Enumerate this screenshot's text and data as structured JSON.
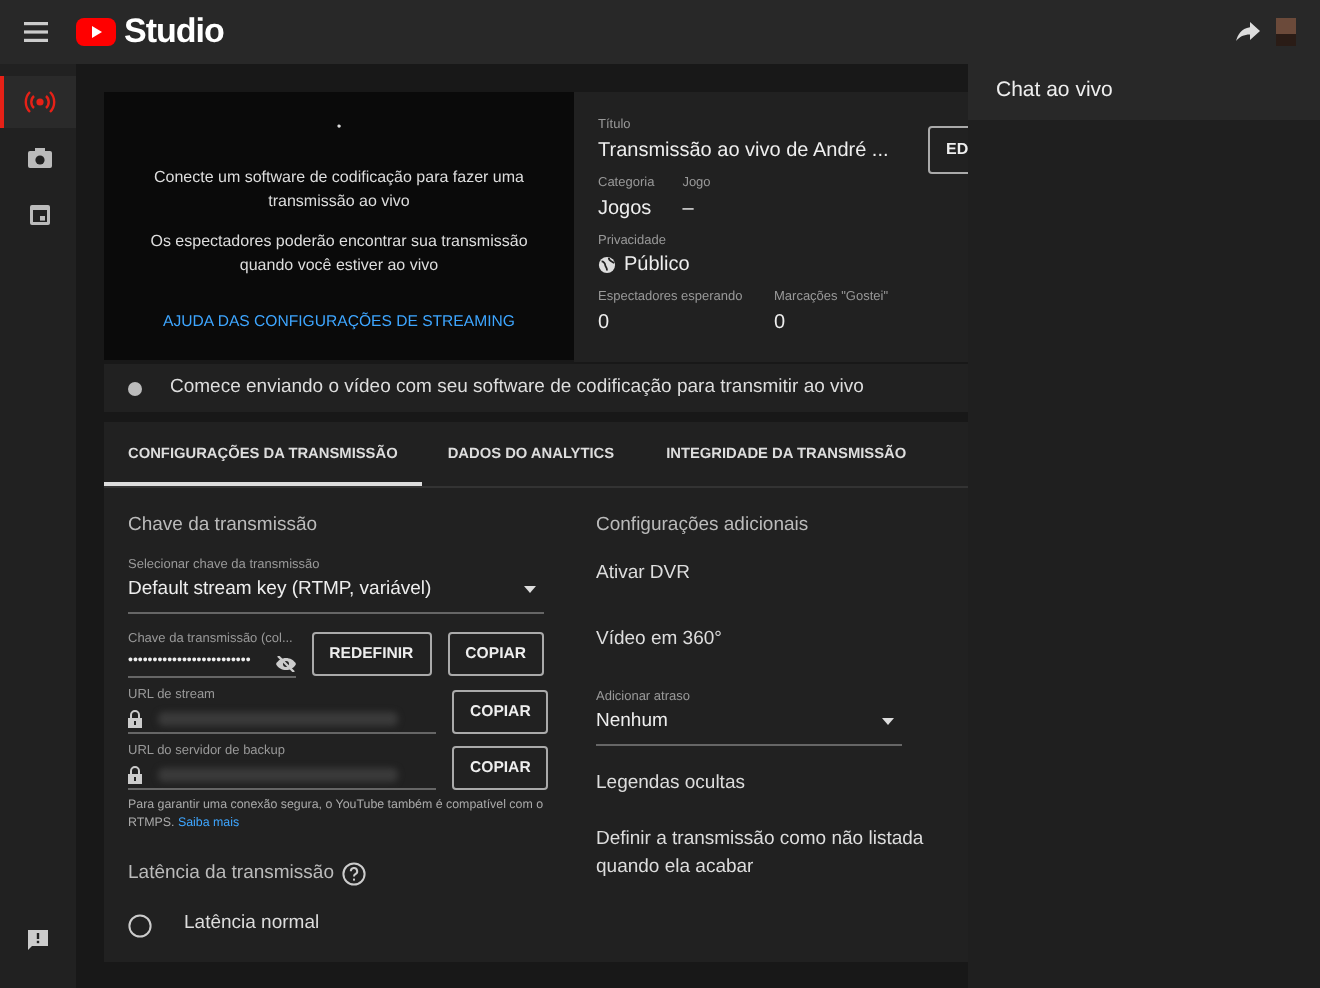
{
  "topbar": {
    "logo_text": "Studio"
  },
  "sidebar": {
    "items": [
      {
        "selected": true
      },
      {
        "selected": false
      },
      {
        "selected": false
      }
    ]
  },
  "preview": {
    "dot": "•",
    "lines": [
      "Conecte um software de codificação para fazer uma transmissão ao vivo",
      "Os espectadores poderão encontrar sua transmissão quando você estiver ao vivo"
    ],
    "help_link": "AJUDA DAS CONFIGURAÇÕES DE STREAMING"
  },
  "details": {
    "title_label": "Título",
    "title": "Transmissão ao vivo de André ...",
    "edit_button": "ED",
    "category_label": "Categoria",
    "category": "Jogos",
    "game_label": "Jogo",
    "game": "–",
    "privacy_label": "Privacidade",
    "privacy": "Público",
    "waiting_label": "Espectadores esperando",
    "waiting": "0",
    "likes_label": "Marcações \"Gostei\"",
    "likes": "0"
  },
  "status": {
    "text": "Comece enviando o vídeo com seu software de codificação para transmitir ao vivo"
  },
  "tabs": [
    {
      "label": "CONFIGURAÇÕES DA TRANSMISSÃO",
      "selected": true
    },
    {
      "label": "DADOS DO ANALYTICS",
      "selected": false
    },
    {
      "label": "INTEGRIDADE DA TRANSMISSÃO",
      "selected": false
    }
  ],
  "stream_key": {
    "heading": "Chave da transmissão",
    "select_label": "Selecionar chave da transmissão",
    "select_value": "Default stream key (RTMP, variável)",
    "key_label": "Chave da transmissão (col...",
    "key_value": "•••••••••••••••••••••••••",
    "reset_button": "REDEFINIR",
    "copy_button": "COPIAR",
    "url_label": "URL de stream",
    "url_copy": "COPIAR",
    "backup_label": "URL do servidor de backup",
    "backup_copy": "COPIAR",
    "note": "Para garantir uma conexão segura, o YouTube também é compatível com o RTMPS.",
    "note_link": "Saiba mais"
  },
  "latency": {
    "heading": "Latência da transmissão",
    "options": [
      {
        "label": "Latência normal",
        "selected": false
      }
    ]
  },
  "additional": {
    "heading": "Configurações adicionais",
    "dvr": "Ativar DVR",
    "video360": "Vídeo em 360°",
    "delay_label": "Adicionar atraso",
    "delay_value": "Nenhum",
    "captions": "Legendas ocultas",
    "unlisted": "Definir a transmissão como não listada quando ela acabar"
  },
  "chat": {
    "title": "Chat ao vivo"
  }
}
